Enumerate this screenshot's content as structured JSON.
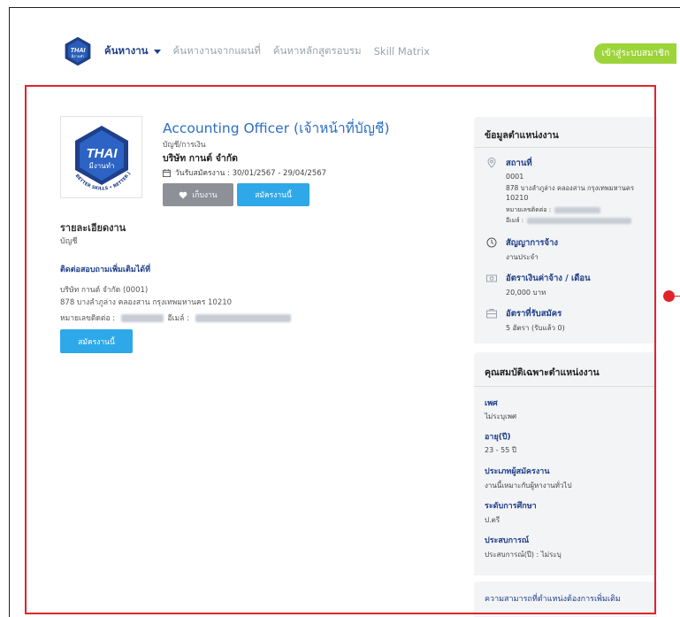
{
  "nav": {
    "logo_text": "THAI",
    "logo_sub": "มีงานทำ",
    "items": [
      "ค้นหางาน",
      "ค้นหางานจากแผนที่",
      "ค้นหาหลักสูตรอบรม",
      "Skill Matrix"
    ],
    "member_label": "เข้าสู่ระบบสมาชิก"
  },
  "job": {
    "logo_text": "THAI",
    "logo_sub": "มีงานทำ",
    "logo_ring": "BETTER SKILLS • BETTER JOBS",
    "title": "Accounting Officer (เจ้าหน้าที่บัญชี)",
    "category": "บัญชี/การเงิน",
    "company": "บริษัท กานต์ จำกัด",
    "dates": "วันรับสมัครงาน : 30/01/2567 - 29/04/2567",
    "save_label": "เก็บงาน",
    "apply_label": "สมัครงานนี้"
  },
  "details": {
    "heading": "รายละเอียดงาน",
    "body": "บัญชี",
    "contact_heading": "ติดต่อสอบถามเพิ่มเติมได้ที่",
    "contact_company": "บริษัท กานต์ จำกัด (0001)",
    "contact_address": "878 บางลำภูล่าง คลองสาน กรุงเทพมหานคร 10210",
    "phone_label": "หมายเลขติดต่อ :",
    "email_label": "อีเมล์ :",
    "apply_label": "สมัครงานนี้"
  },
  "position_info": {
    "title": "ข้อมูลตำแหน่งงาน",
    "location_label": "สถานที่",
    "location_code": "0001",
    "location_address1": "878 บางลำภูล่าง คลองสาน กรุงเทพมหานคร",
    "location_address2": "10210",
    "phone_label": "หมายเลขติดต่อ :",
    "email_label": "อีเมล์ :",
    "contract_label": "สัญญาการจ้าง",
    "contract_value": "งานประจำ",
    "salary_label": "อัตราเงินค่าจ้าง / เดือน",
    "salary_value": "20,000 บาท",
    "positions_label": "อัตราที่รับสมัคร",
    "positions_value": "5 อัตรา (รับแล้ว 0)"
  },
  "qualifications": {
    "title": "คุณสมบัติเฉพาะตำแหน่งงาน",
    "items": [
      {
        "label": "เพศ",
        "value": "ไม่ระบุเพศ"
      },
      {
        "label": "อายุ(ปี)",
        "value": "23 - 55 ปี"
      },
      {
        "label": "ประเภทผู้สมัครงาน",
        "value": "งานนี้เหมาะกับผู้หางานทั่วไป"
      },
      {
        "label": "ระดับการศึกษา",
        "value": "ป.ตรี"
      },
      {
        "label": "ประสบการณ์",
        "value": "ประสบการณ์(ปี) : ไม่ระบุ"
      }
    ]
  },
  "skills": {
    "title": "ความสามารถที่ตำแหน่งต้องการเพิ่มเติม"
  },
  "colors": {
    "brand_blue": "#1f3f8a",
    "accent_blue": "#2ea8e8",
    "member_green": "#9dd43a",
    "highlight_red": "#e0242b"
  }
}
